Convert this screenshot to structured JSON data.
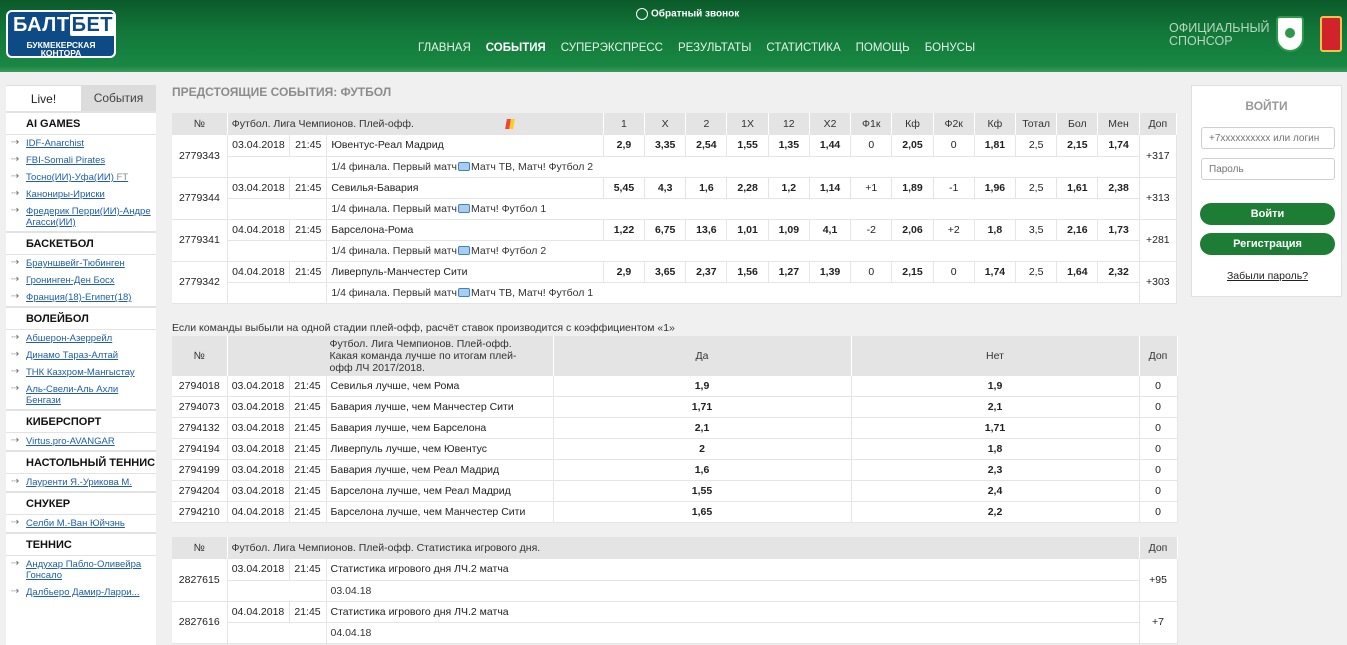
{
  "header": {
    "logo_top": "БАЛТ",
    "logo_top_b": "БЕТ",
    "logo_bottom": "БУКМЕКЕРСКАЯ КОНТОРА",
    "callback": "Обратный звонок",
    "nav": [
      "ГЛАВНАЯ",
      "СОБЫТИЯ",
      "СУПЕРЭКСПРЕСС",
      "РЕЗУЛЬТАТЫ",
      "СТАТИСТИКА",
      "ПОМОЩЬ",
      "БОНУСЫ"
    ],
    "sponsor_line1": "ОФИЦИАЛЬНЫЙ",
    "sponsor_line2": "СПОНСОР"
  },
  "sidebar": {
    "tab_live": "Live!",
    "tab_events": "События",
    "sports": [
      {
        "title": "AI GAMES",
        "items": [
          "IDF-Anarchist",
          "FBI-Somali Pirates",
          "Тосно(ИИ)-Уфа(ИИ)",
          "Канониры-Ириски",
          "Фредерик Перри(ИИ)-Андре Агасси(ИИ)"
        ],
        "ft_index": 2,
        "ft": "FT"
      },
      {
        "title": "БАСКЕТБОЛ",
        "items": [
          "Брауншвейг-Тюбинген",
          "Гронинген-Ден Босх",
          "Франция(18)-Египет(18)"
        ]
      },
      {
        "title": "ВОЛЕЙБОЛ",
        "items": [
          "Абшерон-Азеррейл",
          "Динамо Тараз-Алтай",
          "ТНК Казхром-Мангыстау",
          "Аль-Свели-Аль Ахли Бенгази"
        ]
      },
      {
        "title": "КИБЕРСПОРТ",
        "items": [
          "Virtus.pro-AVANGAR"
        ]
      },
      {
        "title": "НАСТОЛЬНЫЙ ТЕННИС",
        "items": [
          "Лауренти Я.-Урикова М."
        ]
      },
      {
        "title": "СНУКЕР",
        "items": [
          "Селби М.-Ван Юйчэнь"
        ]
      },
      {
        "title": "ТЕННИС",
        "items": [
          "Андухар Пабло-Оливейра Гонсало",
          "Далбьеро Дамир-Ларри..."
        ]
      }
    ]
  },
  "main": {
    "title": "ПРЕДСТОЯЩИЕ СОБЫТИЯ: ФУТБОЛ",
    "t1": {
      "headers": [
        "№",
        "Футбол. Лига Чемпионов. Плей-офф.",
        "1",
        "X",
        "2",
        "1X",
        "12",
        "X2",
        "Ф1к",
        "Кф",
        "Ф2к",
        "Кф",
        "Тотал",
        "Бол",
        "Мен",
        "Доп"
      ],
      "rows": [
        {
          "id": "2779343",
          "date": "03.04.2018",
          "time": "21:45",
          "match": "Ювентус-Реал Мадрид",
          "odds": [
            "2,9",
            "3,35",
            "2,54",
            "1,55",
            "1,35",
            "1,44",
            "0",
            "2,05",
            "0",
            "1,81",
            "2,5",
            "2,15",
            "1,74",
            "+317"
          ],
          "sub1": "1/4 финала. Первый матч",
          "sub2": "Матч ТВ, Матч! Футбол 2"
        },
        {
          "id": "2779344",
          "date": "03.04.2018",
          "time": "21:45",
          "match": "Севилья-Бавария",
          "odds": [
            "5,45",
            "4,3",
            "1,6",
            "2,28",
            "1,2",
            "1,14",
            "+1",
            "1,89",
            "-1",
            "1,96",
            "2,5",
            "1,61",
            "2,38",
            "+313"
          ],
          "sub1": "1/4 финала. Первый матч",
          "sub2": "Матч! Футбол 1"
        },
        {
          "id": "2779341",
          "date": "04.04.2018",
          "time": "21:45",
          "match": "Барселона-Рома",
          "odds": [
            "1,22",
            "6,75",
            "13,6",
            "1,01",
            "1,09",
            "4,1",
            "-2",
            "2,06",
            "+2",
            "1,8",
            "3,5",
            "2,16",
            "1,73",
            "+281"
          ],
          "sub1": "1/4 финала. Первый матч",
          "sub2": "Матч! Футбол 2"
        },
        {
          "id": "2779342",
          "date": "04.04.2018",
          "time": "21:45",
          "match": "Ливерпуль-Манчестер Сити",
          "odds": [
            "2,9",
            "3,65",
            "2,37",
            "1,56",
            "1,27",
            "1,39",
            "0",
            "2,15",
            "0",
            "1,74",
            "2,5",
            "1,64",
            "2,32",
            "+303"
          ],
          "sub1": "1/4 финала. Первый матч",
          "sub2": "Матч ТВ, Матч! Футбол 1"
        }
      ]
    },
    "note": "Если команды выбыли на одной стадии плей-офф, расчёт ставок производится с коэффициентом «1»",
    "t2": {
      "headers": [
        "№",
        "Футбол. Лига Чемпионов. Плей-офф. Какая команда лучше по итогам плей-офф ЛЧ 2017/2018.",
        "Да",
        "Нет",
        "Доп"
      ],
      "rows": [
        {
          "id": "2794018",
          "date": "03.04.2018",
          "time": "21:45",
          "match": "Севилья лучше, чем Рома",
          "yes": "1,9",
          "no": "1,9",
          "dop": "0"
        },
        {
          "id": "2794073",
          "date": "03.04.2018",
          "time": "21:45",
          "match": "Бавария лучше, чем Манчестер Сити",
          "yes": "1,71",
          "no": "2,1",
          "dop": "0"
        },
        {
          "id": "2794132",
          "date": "03.04.2018",
          "time": "21:45",
          "match": "Бавария лучше, чем Барселона",
          "yes": "2,1",
          "no": "1,71",
          "dop": "0"
        },
        {
          "id": "2794194",
          "date": "03.04.2018",
          "time": "21:45",
          "match": "Ливерпуль лучше, чем Ювентус",
          "yes": "2",
          "no": "1,8",
          "dop": "0"
        },
        {
          "id": "2794199",
          "date": "03.04.2018",
          "time": "21:45",
          "match": "Бавария лучше, чем Реал Мадрид",
          "yes": "1,6",
          "no": "2,3",
          "dop": "0"
        },
        {
          "id": "2794204",
          "date": "03.04.2018",
          "time": "21:45",
          "match": "Барселона лучше, чем Реал Мадрид",
          "yes": "1,55",
          "no": "2,4",
          "dop": "0"
        },
        {
          "id": "2794210",
          "date": "04.04.2018",
          "time": "21:45",
          "match": "Барселона лучше, чем Манчестер Сити",
          "yes": "1,65",
          "no": "2,2",
          "dop": "0"
        }
      ]
    },
    "t3": {
      "headers": [
        "№",
        "Футбол. Лига Чемпионов. Плей-офф. Статистика игрового дня.",
        "Доп"
      ],
      "rows": [
        {
          "id": "2827615",
          "date": "03.04.2018",
          "time": "21:45",
          "match": "Статистика игрового дня ЛЧ.2 матча",
          "dop": "+95",
          "sub": "03.04.18"
        },
        {
          "id": "2827616",
          "date": "04.04.2018",
          "time": "21:45",
          "match": "Статистика игрового дня ЛЧ.2 матча",
          "dop": "+7",
          "sub": "04.04.18"
        }
      ]
    }
  },
  "login": {
    "title": "ВОЙТИ",
    "phone_placeholder": "+7xxxxxxxxxx или логин",
    "password_placeholder": "Пароль",
    "login_button": "Войти",
    "register_button": "Регистрация",
    "forgot": "Забыли пароль?"
  }
}
